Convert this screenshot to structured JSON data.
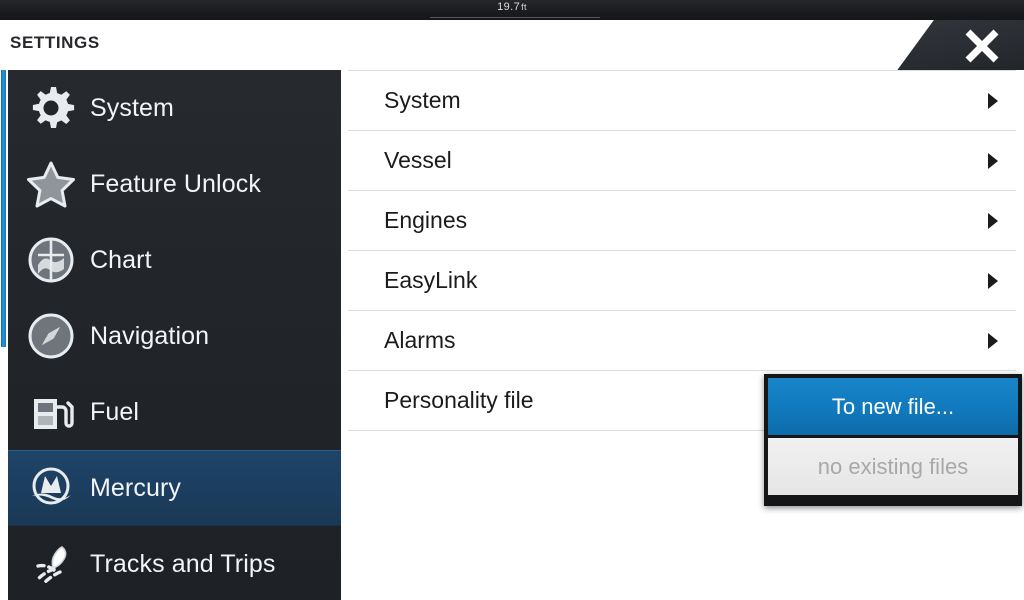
{
  "topbar": {
    "depth_value": "19.7",
    "depth_unit": "ft"
  },
  "header": {
    "title": "SETTINGS",
    "close_icon": "close-icon"
  },
  "sidebar": {
    "items": [
      {
        "label": "System",
        "icon": "gear-icon",
        "selected": false
      },
      {
        "label": "Feature Unlock",
        "icon": "star-icon",
        "selected": false
      },
      {
        "label": "Chart",
        "icon": "chart-icon",
        "selected": false
      },
      {
        "label": "Navigation",
        "icon": "compass-icon",
        "selected": false
      },
      {
        "label": "Fuel",
        "icon": "fuel-icon",
        "selected": false
      },
      {
        "label": "Mercury",
        "icon": "mercury-icon",
        "selected": true
      },
      {
        "label": "Tracks and Trips",
        "icon": "track-icon",
        "selected": false
      }
    ]
  },
  "main": {
    "rows": [
      {
        "label": "System",
        "chevron": "chevron-right-icon",
        "has_chevron": true
      },
      {
        "label": "Vessel",
        "chevron": "chevron-right-icon",
        "has_chevron": true
      },
      {
        "label": "Engines",
        "chevron": "chevron-right-icon",
        "has_chevron": true
      },
      {
        "label": "EasyLink",
        "chevron": "chevron-right-icon",
        "has_chevron": true
      },
      {
        "label": "Alarms",
        "chevron": "chevron-right-icon",
        "has_chevron": true
      },
      {
        "label": "Personality file",
        "chevron": "",
        "has_chevron": false
      }
    ]
  },
  "popup": {
    "items": [
      {
        "label": "To new file...",
        "state": "active"
      },
      {
        "label": "no existing files",
        "state": "disabled"
      }
    ]
  },
  "colors": {
    "accent_blue": "#1179bd",
    "selected_row_blue": "#1c3e60",
    "sidebar_dark": "#22262a",
    "topbar_dark": "#1b1d20",
    "disabled_grey": "#a8a8a8"
  }
}
